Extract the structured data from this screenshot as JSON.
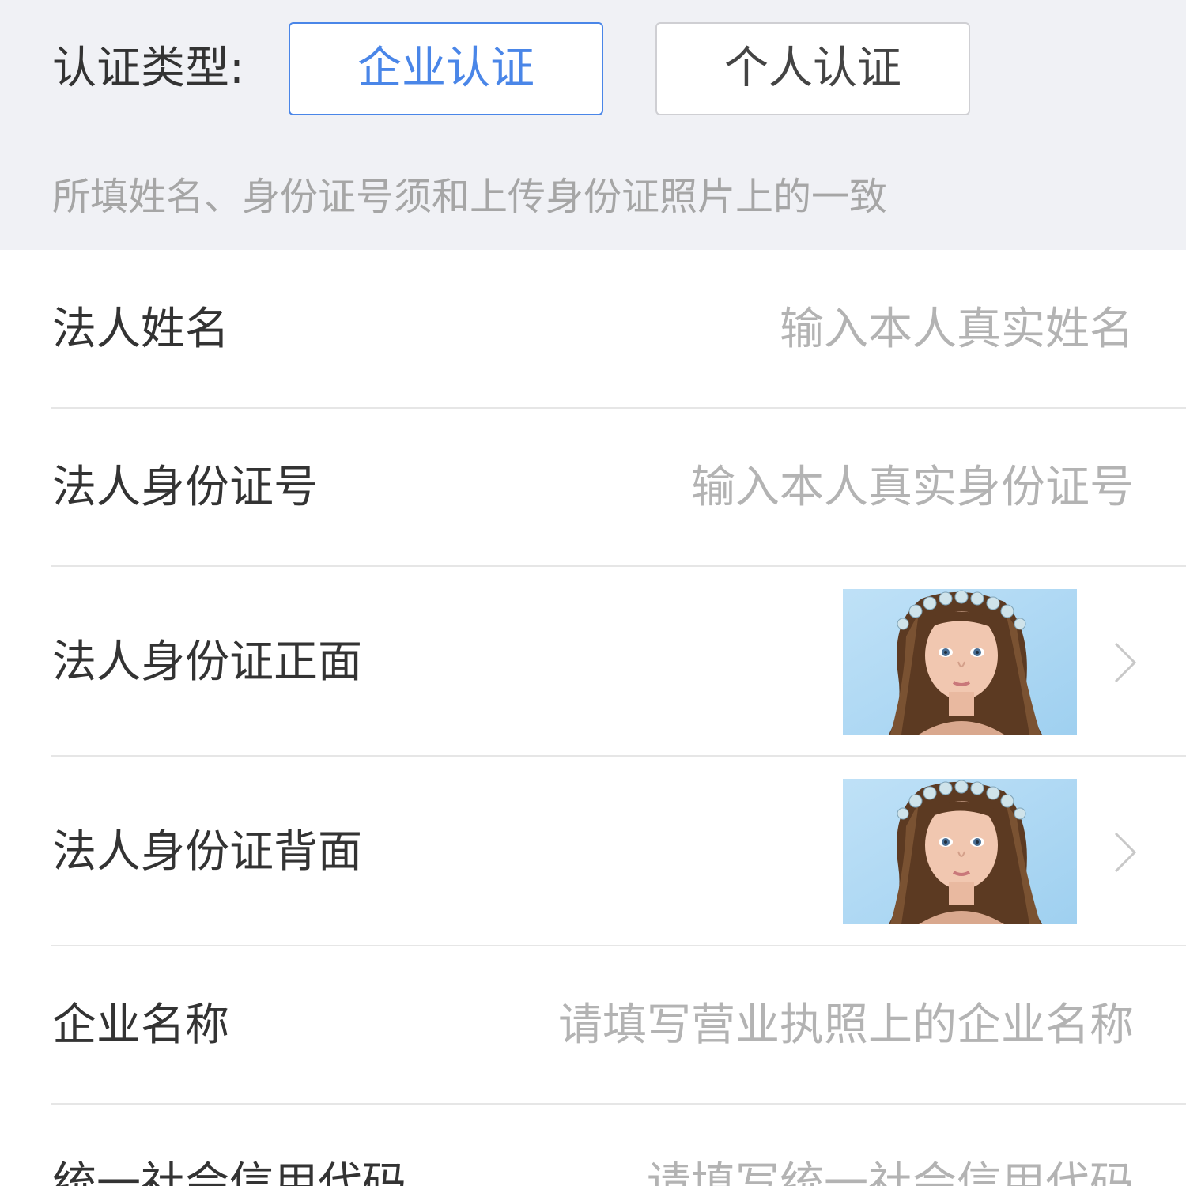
{
  "auth_type": {
    "label": "认证类型:",
    "options": [
      {
        "label": "企业认证",
        "selected": true
      },
      {
        "label": "个人认证",
        "selected": false
      }
    ]
  },
  "hint": "所填姓名、身份证号须和上传身份证照片上的一致",
  "form": {
    "legal_name": {
      "label": "法人姓名",
      "placeholder": "输入本人真实姓名"
    },
    "legal_id": {
      "label": "法人身份证号",
      "placeholder": "输入本人真实身份证号"
    },
    "id_front": {
      "label": "法人身份证正面",
      "photo": "id-front-photo",
      "icon": "chevron-right-icon"
    },
    "id_back": {
      "label": "法人身份证背面",
      "photo": "id-back-photo",
      "icon": "chevron-right-icon"
    },
    "company_name": {
      "label": "企业名称",
      "placeholder": "请填写营业执照上的企业名称"
    },
    "credit_code": {
      "label": "统一社会信用代码",
      "placeholder": "请填写统一社会信用代码"
    }
  },
  "colors": {
    "accent": "#4a86e8",
    "top_background": "#f0f1f5",
    "placeholder": "#b3b3b3",
    "label": "#333333"
  }
}
